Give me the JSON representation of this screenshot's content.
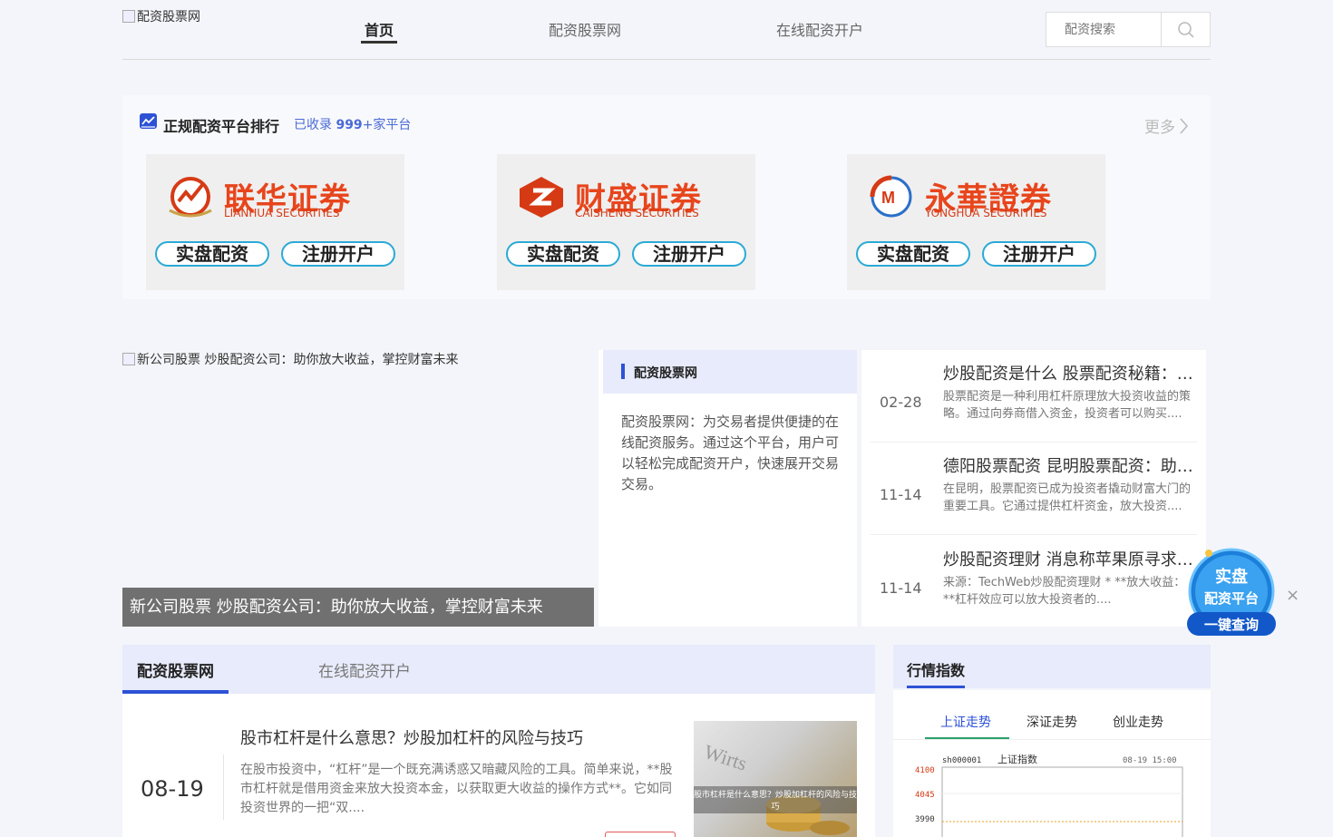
{
  "header": {
    "logo_alt": "配资股票网",
    "nav": [
      {
        "label": "首页",
        "active": true
      },
      {
        "label": "配资股票网",
        "active": false
      },
      {
        "label": "在线配资开户",
        "active": false
      }
    ],
    "search_placeholder": "配资搜索"
  },
  "ranking": {
    "title": "正规配资平台排行",
    "count_prefix": "已收录",
    "count_value": "999",
    "count_suffix": "+家平台",
    "more_label": "更多",
    "brokers": [
      {
        "name": "联华证券",
        "subtitle": "LIANHUA SECURITIES",
        "btn1": "实盘配资",
        "btn2": "注册开户"
      },
      {
        "name": "财盛证券",
        "subtitle": "CAISHENG SECURITIES",
        "btn1": "实盘配资",
        "btn2": "注册开户"
      },
      {
        "name": "永華證券",
        "subtitle": "YONGHUA SECURITIES",
        "btn1": "实盘配资",
        "btn2": "注册开户"
      }
    ]
  },
  "featured": {
    "image_alt": "新公司股票 炒股配资公司：助你放大收益，掌控财富未来",
    "caption": "新公司股票 炒股配资公司：助你放大收益，掌控财富未来"
  },
  "info": {
    "title": "配资股票网",
    "text": "配资股票网：为交易者提供便捷的在线配资服务。通过这个平台，用户可以轻松完成配资开户，快速展开交易交易。"
  },
  "news": [
    {
      "date": "02-28",
      "title": "炒股配资是什么 股票配资秘籍：利用杠杆撬动财富大门",
      "summary": "股票配资是一种利用杠杆原理放大投资收益的策略。通过向券商借入资金，投资者可以购买...."
    },
    {
      "date": "11-14",
      "title": "德阳股票配资 昆明股票配资：助力投资者撬动财富大门",
      "summary": "在昆明，股票配资已成为投资者撬动财富大门的重要工具。它通过提供杠杆资金，放大投资...."
    },
    {
      "date": "11-14",
      "title": "炒股配资理财 消息称苹果原寻求与国内企业合作",
      "summary": "来源：TechWeb炒股配资理财 * **放大收益：**杠杆效应可以放大投资者的...."
    }
  ],
  "float_badge": {
    "line1": "实盘",
    "line2": "配资平台",
    "line3": "一键查询",
    "close": "×"
  },
  "tabs": {
    "tab1": "配资股票网",
    "tab2": "在线配资开户"
  },
  "article": {
    "date": "08-19",
    "title": "股市杠杆是什么意思？炒股加杠杆的风险与技巧",
    "summary": "在股市投资中，“杠杆”是一个既充满诱惑又暗藏风险的工具。简单来说，**股市杠杆就是借用资金来放大投资本金，以获取更大收益的操作方式**。它如同投资世界的一把“双....",
    "image_caption": "股市杠杆是什么意思？炒股加杠杆的风险与技巧"
  },
  "market": {
    "title": "行情指数",
    "tabs": [
      "上证走势",
      "深证走势",
      "创业走势"
    ],
    "chart": {
      "code": "sh000001",
      "name": "上证指数",
      "timestamp": "08-19 15:00",
      "y_ticks": [
        "4100",
        "4045",
        "3990"
      ]
    }
  },
  "colors": {
    "accent": "#2d52d6",
    "tab_bg": "#e8ebfb",
    "red": "#e8451c",
    "green": "#2aa06a"
  }
}
